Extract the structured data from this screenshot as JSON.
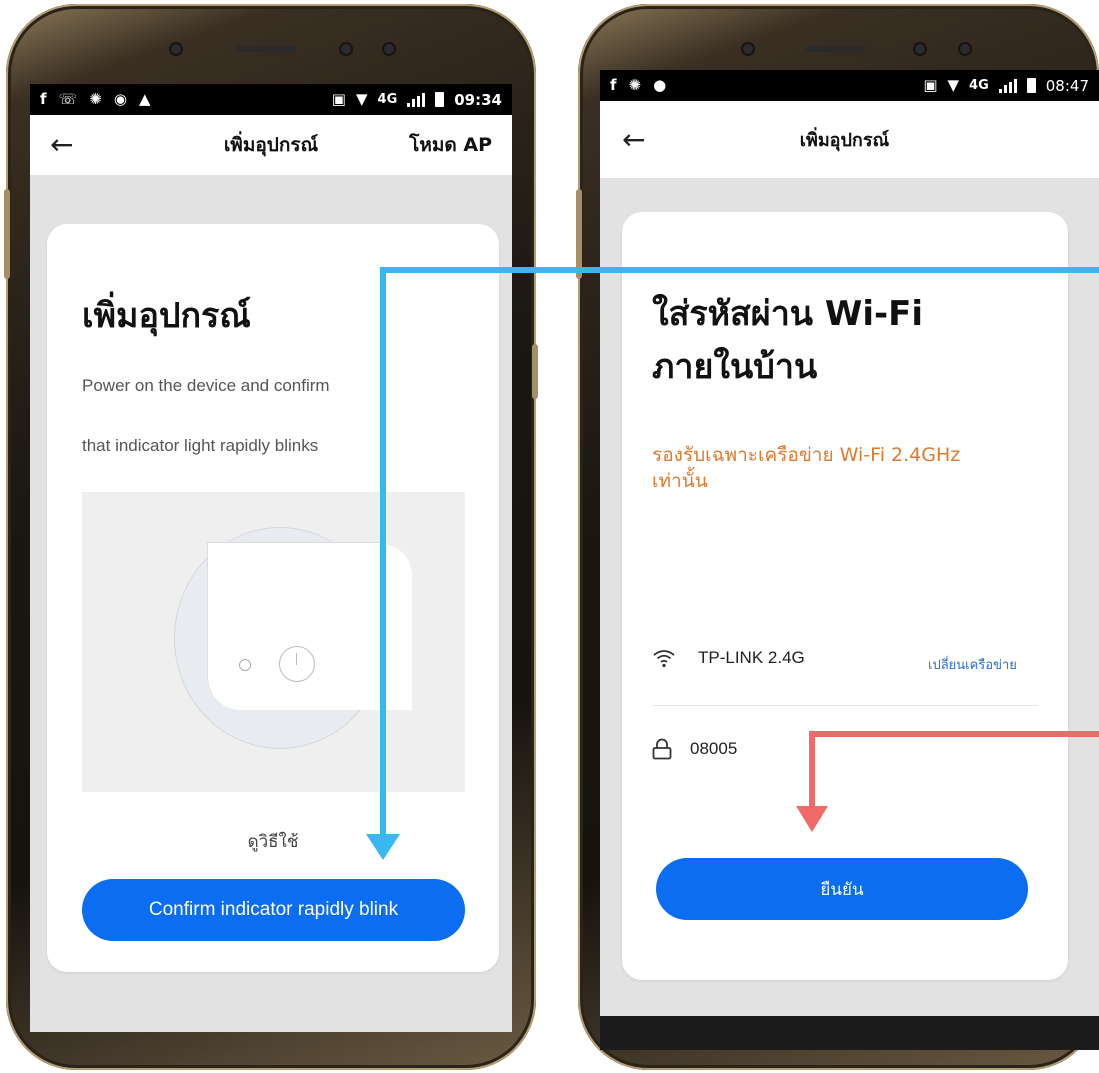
{
  "colors": {
    "primary_button": "#0a6df2",
    "warning_text": "#e07b2e",
    "link_text": "#2d6fd1",
    "annotation_blue": "#38b8f0",
    "annotation_red": "#f06a6a"
  },
  "left_phone": {
    "status": {
      "left_icons": [
        "facebook-icon",
        "line-chat-icon",
        "aperture-icon",
        "line-app-icon",
        "warning-icon"
      ],
      "network": "4G",
      "time": "09:34"
    },
    "appbar": {
      "back_icon": "back-arrow-icon",
      "title": "เพิ่มอุปกรณ์",
      "action": "โหมด AP"
    },
    "card": {
      "title": "เพิ่มอุปกรณ์",
      "desc_line1": "Power on the device and confirm",
      "desc_line2": "that indicator light rapidly blinks",
      "illustration_icons": [
        "indicator-led-icon",
        "power-icon"
      ],
      "howto": "ดูวิธีใช้",
      "confirm_button": "Confirm indicator rapidly blink"
    }
  },
  "right_phone": {
    "status": {
      "left_icons": [
        "facebook-icon",
        "aperture-icon",
        "chat-icon"
      ],
      "network": "4G",
      "time": "08:47"
    },
    "appbar": {
      "back_icon": "back-arrow-icon",
      "title": "เพิ่มอุปกรณ์"
    },
    "card": {
      "title_line1": "ใส่รหัสผ่าน Wi-Fi",
      "title_line2": "ภายในบ้าน",
      "warning_line1": "รองรับเฉพาะเครือข่าย Wi-Fi 2.4GHz",
      "warning_line2": "เท่านั้น",
      "wifi_icon": "wifi-icon",
      "wifi_name": "TP-LINK 2.4G",
      "change_network": "เปลี่ยนเครือข่าย",
      "lock_icon": "lock-icon",
      "password_value": "08005",
      "confirm_button": "ยืนยัน"
    }
  }
}
